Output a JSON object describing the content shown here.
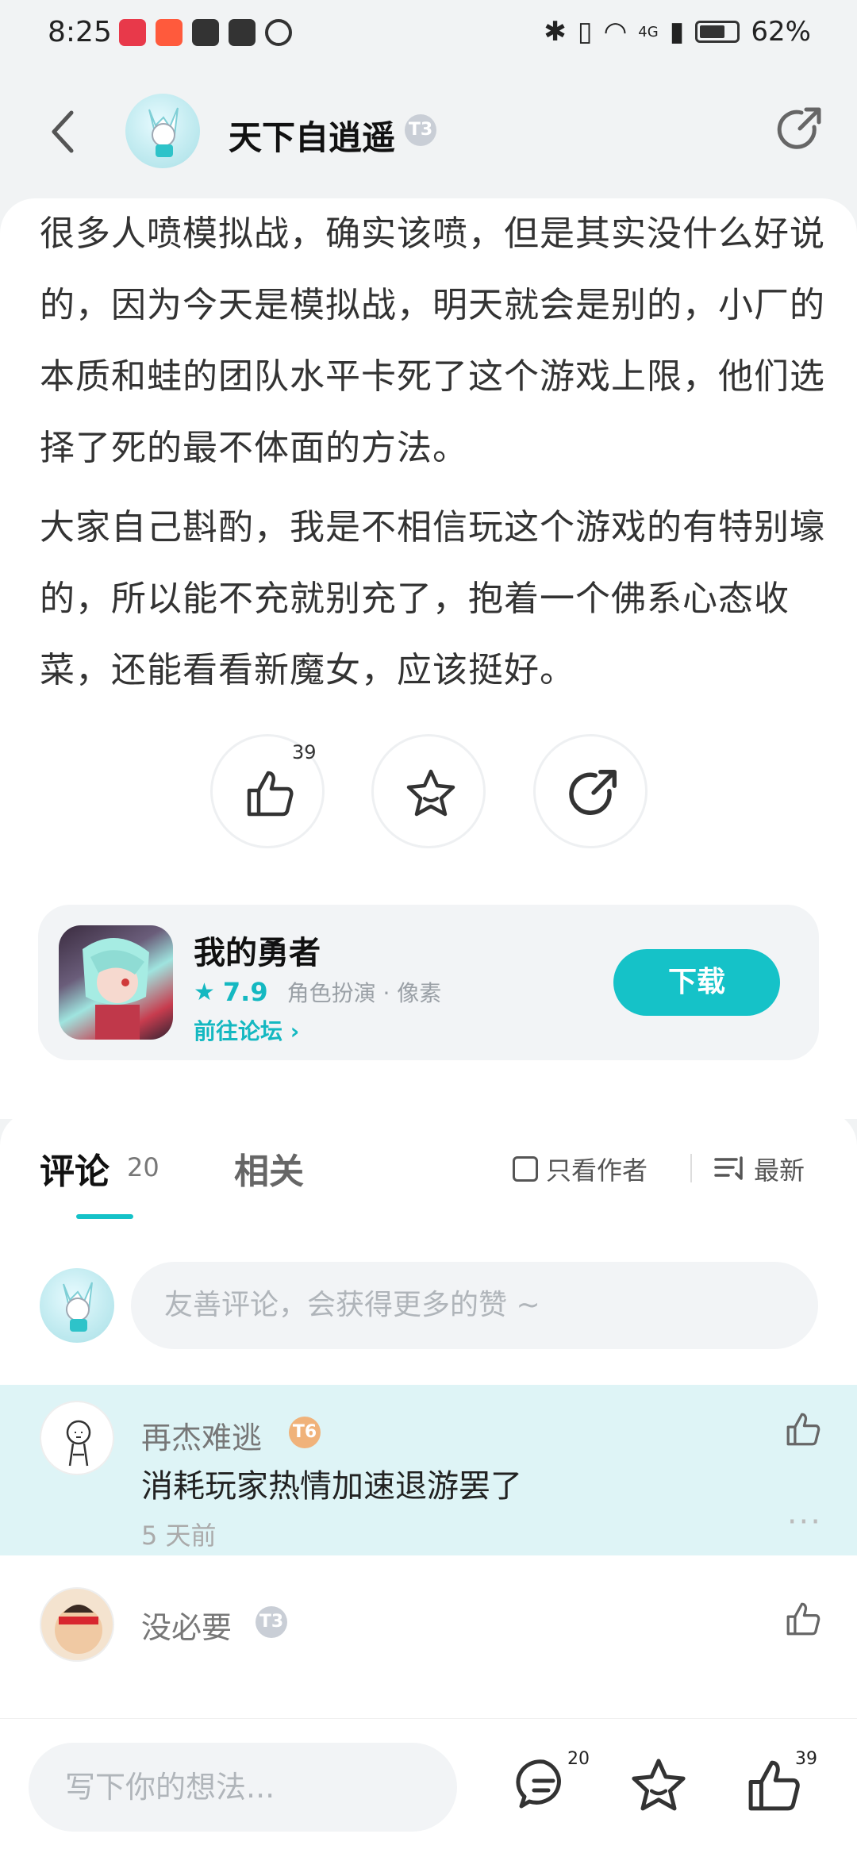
{
  "status_bar": {
    "time": "8:25",
    "battery": "62%",
    "network": "4G"
  },
  "header": {
    "username": "天下自逍遥",
    "level": "T3"
  },
  "article": {
    "paragraph1": "很多人喷模拟战，确实该喷，但是其实没什么好说的，因为今天是模拟战，明天就会是别的，小厂的本质和蛙的团队水平卡死了这个游戏上限，他们选择了死的最不体面的方法。",
    "paragraph2": "大家自己斟酌，我是不相信玩这个游戏的有特别壕的，所以能不充就别充了，抱着一个佛系心态收菜，还能看看新魔女，应该挺好。",
    "like_count": "39"
  },
  "game": {
    "title": "我的勇者",
    "rating": "7.9",
    "tags": "角色扮演 · 像素",
    "forum_link": "前往论坛",
    "download": "下载"
  },
  "comments": {
    "tab_comments": "评论",
    "tab_comments_count": "20",
    "tab_related": "相关",
    "only_author": "只看作者",
    "sort": "最新",
    "input_placeholder": "友善评论，会获得更多的赞 ~",
    "items": [
      {
        "name": "再杰难逃",
        "level": "T6",
        "text": "消耗玩家热情加速退游罢了",
        "time": "5 天前"
      },
      {
        "name": "没必要",
        "level": "T3"
      }
    ]
  },
  "bottom_bar": {
    "placeholder": "写下你的想法...",
    "comment_count": "20",
    "like_count": "39"
  },
  "colors": {
    "accent": "#15c2c8",
    "highlight": "#def4f6"
  }
}
